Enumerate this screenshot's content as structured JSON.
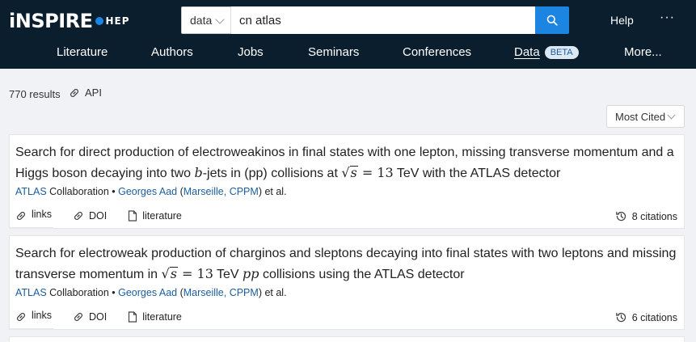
{
  "brand": {
    "logo_text": "iNSPIRE",
    "logo_suffix": "HEP"
  },
  "search": {
    "scope": "data",
    "query": "cn atlas",
    "icon": "search-icon"
  },
  "header_links": {
    "help": "Help",
    "more": "···"
  },
  "nav": [
    {
      "label": "Literature"
    },
    {
      "label": "Authors"
    },
    {
      "label": "Jobs"
    },
    {
      "label": "Seminars"
    },
    {
      "label": "Conferences"
    },
    {
      "label": "Data",
      "badge": "BETA",
      "active": true
    },
    {
      "label": "More..."
    }
  ],
  "results": {
    "count_text": "770 results",
    "api_label": "API",
    "sort_value": "Most Cited"
  },
  "records": [
    {
      "title_prefix": "Search for direct production of electroweakinos in final states with one lepton, missing transverse momentum and a Higgs boson decaying into two ",
      "title_b": "b",
      "title_mid": "-jets in (pp) collisions at ",
      "title_sqrt_var": "s",
      "title_eq": " = 13",
      "title_suffix": " TeV with the ATLAS detector",
      "collab_link": "ATLAS",
      "collab_text": " Collaboration • ",
      "author": "Georges Aad",
      "affil_open": " (",
      "affil": "Marseille, CPPM",
      "affil_close": ") et al.",
      "actions": [
        "links",
        "DOI",
        "literature"
      ],
      "citations": "8 citations"
    },
    {
      "title_prefix": "Search for electroweak production of charginos and sleptons decaying into final states with two leptons and missing transverse momentum in ",
      "title_sqrt_var": "s",
      "title_eq": " = 13",
      "title_mid": " TeV ",
      "title_pp": "pp",
      "title_suffix": " collisions using the ATLAS detector",
      "collab_link": "ATLAS",
      "collab_text": " Collaboration • ",
      "author": "Georges Aad",
      "affil_open": " (",
      "affil": "Marseille, CPPM",
      "affil_close": ") et al.",
      "actions": [
        "links",
        "DOI",
        "literature"
      ],
      "citations": "6 citations"
    }
  ]
}
